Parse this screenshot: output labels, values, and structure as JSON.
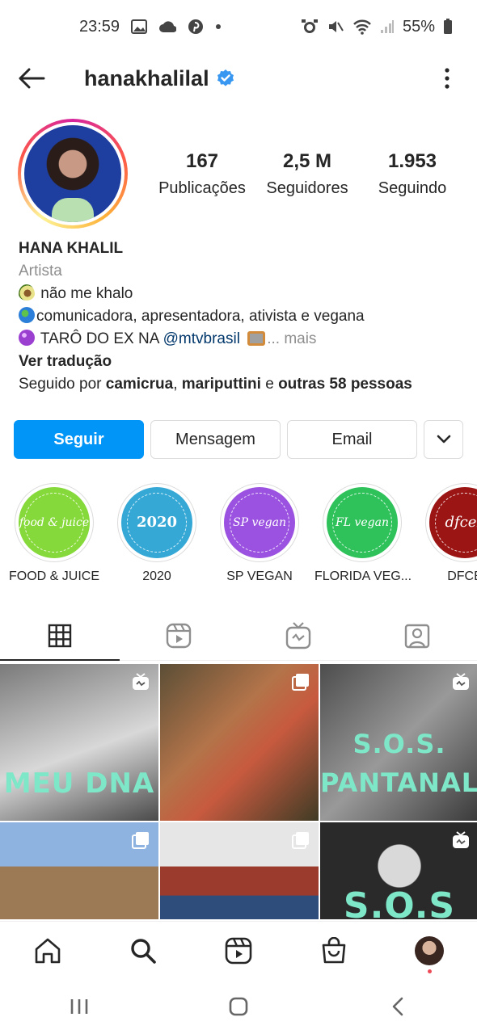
{
  "status_bar": {
    "time": "23:59",
    "battery": "55%"
  },
  "header": {
    "username": "hanakhalilal"
  },
  "stats": [
    {
      "value": "167",
      "label": "Publicações"
    },
    {
      "value": "2,5 M",
      "label": "Seguidores"
    },
    {
      "value": "1.953",
      "label": "Seguindo"
    }
  ],
  "bio": {
    "name": "HANA KHALIL",
    "category": "Artista",
    "line1": " não me khalo",
    "line2": "comunicadora, apresentadora, ativista e vegana",
    "line3_prefix": " TARÔ DO EX NA ",
    "line3_mention": "@mtvbrasil",
    "line3_more": "... mais",
    "translate": "Ver tradução",
    "followed_prefix": "Seguido por ",
    "followed_user1": "camicrua",
    "followed_sep": ", ",
    "followed_user2": "mariputtini",
    "followed_and": " e ",
    "followed_others": "outras 58 pessoas"
  },
  "actions": {
    "follow": "Seguir",
    "message": "Mensagem",
    "email": "Email"
  },
  "highlights": [
    {
      "cover_text": "food & juice",
      "label": "FOOD & JUICE",
      "color": "#86d93a"
    },
    {
      "cover_text": "2020",
      "label": "2020",
      "color": "#35a8d6"
    },
    {
      "cover_text": "SP vegan",
      "label": "SP VEGAN",
      "color": "#9b52e0"
    },
    {
      "cover_text": "FL vegan",
      "label": "FLORIDA VEG...",
      "color": "#2fc25b"
    },
    {
      "cover_text": "dfcex",
      "label": "DFCE",
      "color": "#9b1515"
    }
  ],
  "posts": [
    {
      "caption": "MEU DNA"
    },
    {
      "caption": ""
    },
    {
      "caption_line1": "S.O.S.",
      "caption_line2": "PANTANAL"
    },
    {
      "caption": ""
    },
    {
      "caption": ""
    },
    {
      "caption": "S.O.S"
    }
  ],
  "colors": {
    "accent": "#0095f6",
    "verified": "#3897f0"
  }
}
